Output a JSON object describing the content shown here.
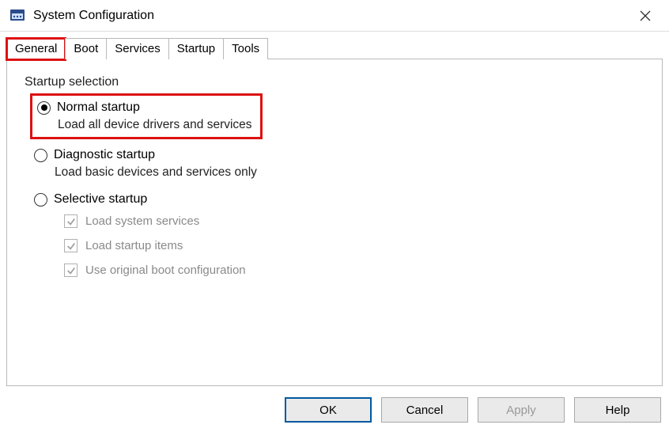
{
  "window": {
    "title": "System Configuration"
  },
  "tabs": {
    "general": "General",
    "boot": "Boot",
    "services": "Services",
    "startup": "Startup",
    "tools": "Tools"
  },
  "group": {
    "title": "Startup selection",
    "normal": {
      "label": "Normal startup",
      "desc": "Load all device drivers and services",
      "checked": true
    },
    "diagnostic": {
      "label": "Diagnostic startup",
      "desc": "Load basic devices and services only",
      "checked": false
    },
    "selective": {
      "label": "Selective startup",
      "checked": false,
      "sys_services": "Load system services",
      "startup_items": "Load startup items",
      "original_boot": "Use original boot configuration"
    }
  },
  "buttons": {
    "ok": "OK",
    "cancel": "Cancel",
    "apply": "Apply",
    "help": "Help"
  }
}
